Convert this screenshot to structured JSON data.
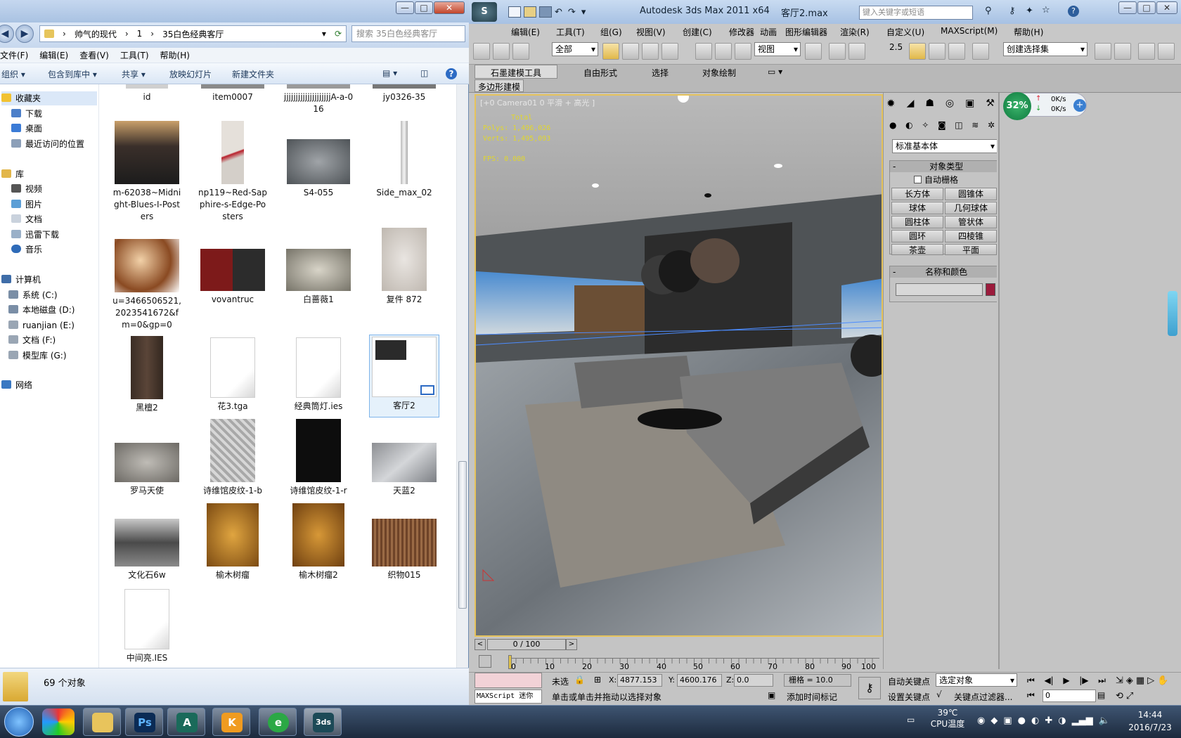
{
  "explorer": {
    "window_buttons": [
      "—",
      "□",
      "✕"
    ],
    "breadcrumb": [
      "帅气的现代",
      "1",
      "35白色经典客厅"
    ],
    "search_placeholder": "搜索 35白色经典客厅",
    "menu": [
      "文件(F)",
      "编辑(E)",
      "查看(V)",
      "工具(T)",
      "帮助(H)"
    ],
    "commands": [
      "组织 ▾",
      "包含到库中 ▾",
      "共享 ▾",
      "放映幻灯片",
      "新建文件夹"
    ],
    "nav": {
      "favorites": {
        "title": "收藏夹",
        "items": [
          "下载",
          "桌面",
          "最近访问的位置"
        ]
      },
      "libraries": {
        "title": "库",
        "items": [
          "视频",
          "图片",
          "文档",
          "迅雷下载",
          "音乐"
        ]
      },
      "computer": {
        "title": "计算机",
        "items": [
          "系统 (C:)",
          "本地磁盘 (D:)",
          "ruanjian (E:)",
          "文档 (F:)",
          "模型库 (G:)"
        ]
      },
      "network": {
        "title": "网络"
      }
    },
    "files": [
      {
        "name": "id"
      },
      {
        "name": "item0007"
      },
      {
        "name": "jjjjjjjjjjjjjjjjjjjjA-a-016"
      },
      {
        "name": "jy0326-35"
      },
      {
        "name": "m-62038~Midnight-Blues-I-Posters"
      },
      {
        "name": "np119~Red-Sapphire-s-Edge-Posters"
      },
      {
        "name": "S4-055"
      },
      {
        "name": "Side_max_02"
      },
      {
        "name": "u=3466506521,2023541672&fm=0&gp=0"
      },
      {
        "name": "vovantruc"
      },
      {
        "name": "白蔷薇1"
      },
      {
        "name": "复件 872"
      },
      {
        "name": "黑檀2"
      },
      {
        "name": "花3.tga"
      },
      {
        "name": "经典筒灯.ies"
      },
      {
        "name": "客厅2"
      },
      {
        "name": "罗马天使"
      },
      {
        "name": "诗维馆皮纹-1-b"
      },
      {
        "name": "诗维馆皮纹-1-r"
      },
      {
        "name": "天蓝2"
      },
      {
        "name": "文化石6w"
      },
      {
        "name": "榆木树瘤"
      },
      {
        "name": "榆木树瘤2"
      },
      {
        "name": "织物015"
      },
      {
        "name": "中间亮.IES"
      }
    ],
    "status": "69 个对象"
  },
  "max": {
    "title": "Autodesk 3ds Max  2011 x64",
    "file": "客厅2.max",
    "search_placeholder": "键入关键字或短语",
    "menu": [
      "编辑(E)",
      "工具(T)",
      "组(G)",
      "视图(V)",
      "创建(C)",
      "修改器",
      "动画",
      "图形编辑器",
      "渲染(R)",
      "自定义(U)",
      "MAXScript(M)",
      "帮助(H)"
    ],
    "toolbar": {
      "filter": "全部",
      "ref_coord": "视图",
      "selection_set": "创建选择集",
      "snap": "2.5"
    },
    "ribbon_tabs": [
      "石墨建模工具",
      "自由形式",
      "选择",
      "对象绘制"
    ],
    "ribbon_sub": "多边形建模",
    "viewport": {
      "label": "[+0 Camera01 0 平滑 + 高光 ]",
      "stats": [
        "Total",
        "Polys: 1,496,026",
        "Verts: 1,495,093",
        "FPS:   0.000"
      ]
    },
    "panel": {
      "dropdown": "标准基本体",
      "object_type_title": "对象类型",
      "autogrid": "自动栅格",
      "buttons": [
        "长方体",
        "圆锥体",
        "球体",
        "几何球体",
        "圆柱体",
        "管状体",
        "圆环",
        "四棱锥",
        "茶壶",
        "平面"
      ],
      "name_color_title": "名称和颜色",
      "color": "#9b1b3c"
    },
    "network_widget": {
      "percent": "32%",
      "up": "0K/s",
      "down": "0K/s"
    },
    "time_slider": "0 / 100",
    "ruler_ticks": [
      "0",
      "10",
      "20",
      "30",
      "40",
      "50",
      "60",
      "70",
      "80",
      "90",
      "100"
    ],
    "status": {
      "selected": "未选",
      "x_label": "X:",
      "x": "4877.153",
      "y_label": "Y:",
      "y": "4600.176",
      "z_label": "Z:",
      "z": "0.0",
      "grid": "栅格 = 10.0",
      "auto_key": "自动关键点",
      "selected_obj": "选定对象",
      "set_key": "设置关键点",
      "key_filter": "关键点过滤器...",
      "frame": "0",
      "maxscript": "MAXScript 迷你",
      "prompt": "单击或单击并拖动以选择对象",
      "add_time_tag": "添加时间标记"
    }
  },
  "taskbar": {
    "apps": [
      "Ps",
      "A",
      "K",
      "e",
      "3ds"
    ],
    "temp": "39℃",
    "temp_label": "CPU温度",
    "time": "14:44",
    "date": "2016/7/23"
  }
}
